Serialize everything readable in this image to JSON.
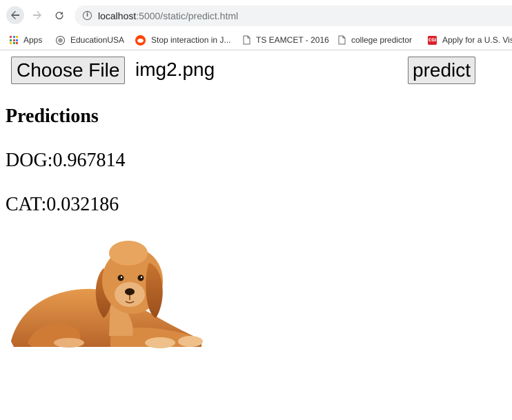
{
  "browser": {
    "url_host": "localhost",
    "url_rest": ":5000/static/predict.html"
  },
  "bookmarks": [
    {
      "label": "Apps",
      "icon": "apps-grid-icon"
    },
    {
      "label": "EducationUSA",
      "icon": "seal-icon"
    },
    {
      "label": "Stop interaction in J...",
      "icon": "reddit-icon"
    },
    {
      "label": "TS EAMCET - 2016",
      "icon": "page-icon"
    },
    {
      "label": "college predictor",
      "icon": "page-icon"
    },
    {
      "label": "Apply for a U.S. Vis",
      "icon": "cgi-icon"
    }
  ],
  "form": {
    "choose_file_label": "Choose File",
    "file_name": "img2.png",
    "predict_label": "predict"
  },
  "predictions": {
    "title": "Predictions",
    "items": [
      {
        "label": "DOG",
        "score": "0.967814",
        "text": "DOG:0.967814"
      },
      {
        "label": "CAT",
        "score": "0.032186",
        "text": "CAT:0.032186"
      }
    ]
  },
  "colors": {
    "reddit": "#ff4500",
    "cgi": "#d9232e",
    "fur": "#d9883f"
  }
}
